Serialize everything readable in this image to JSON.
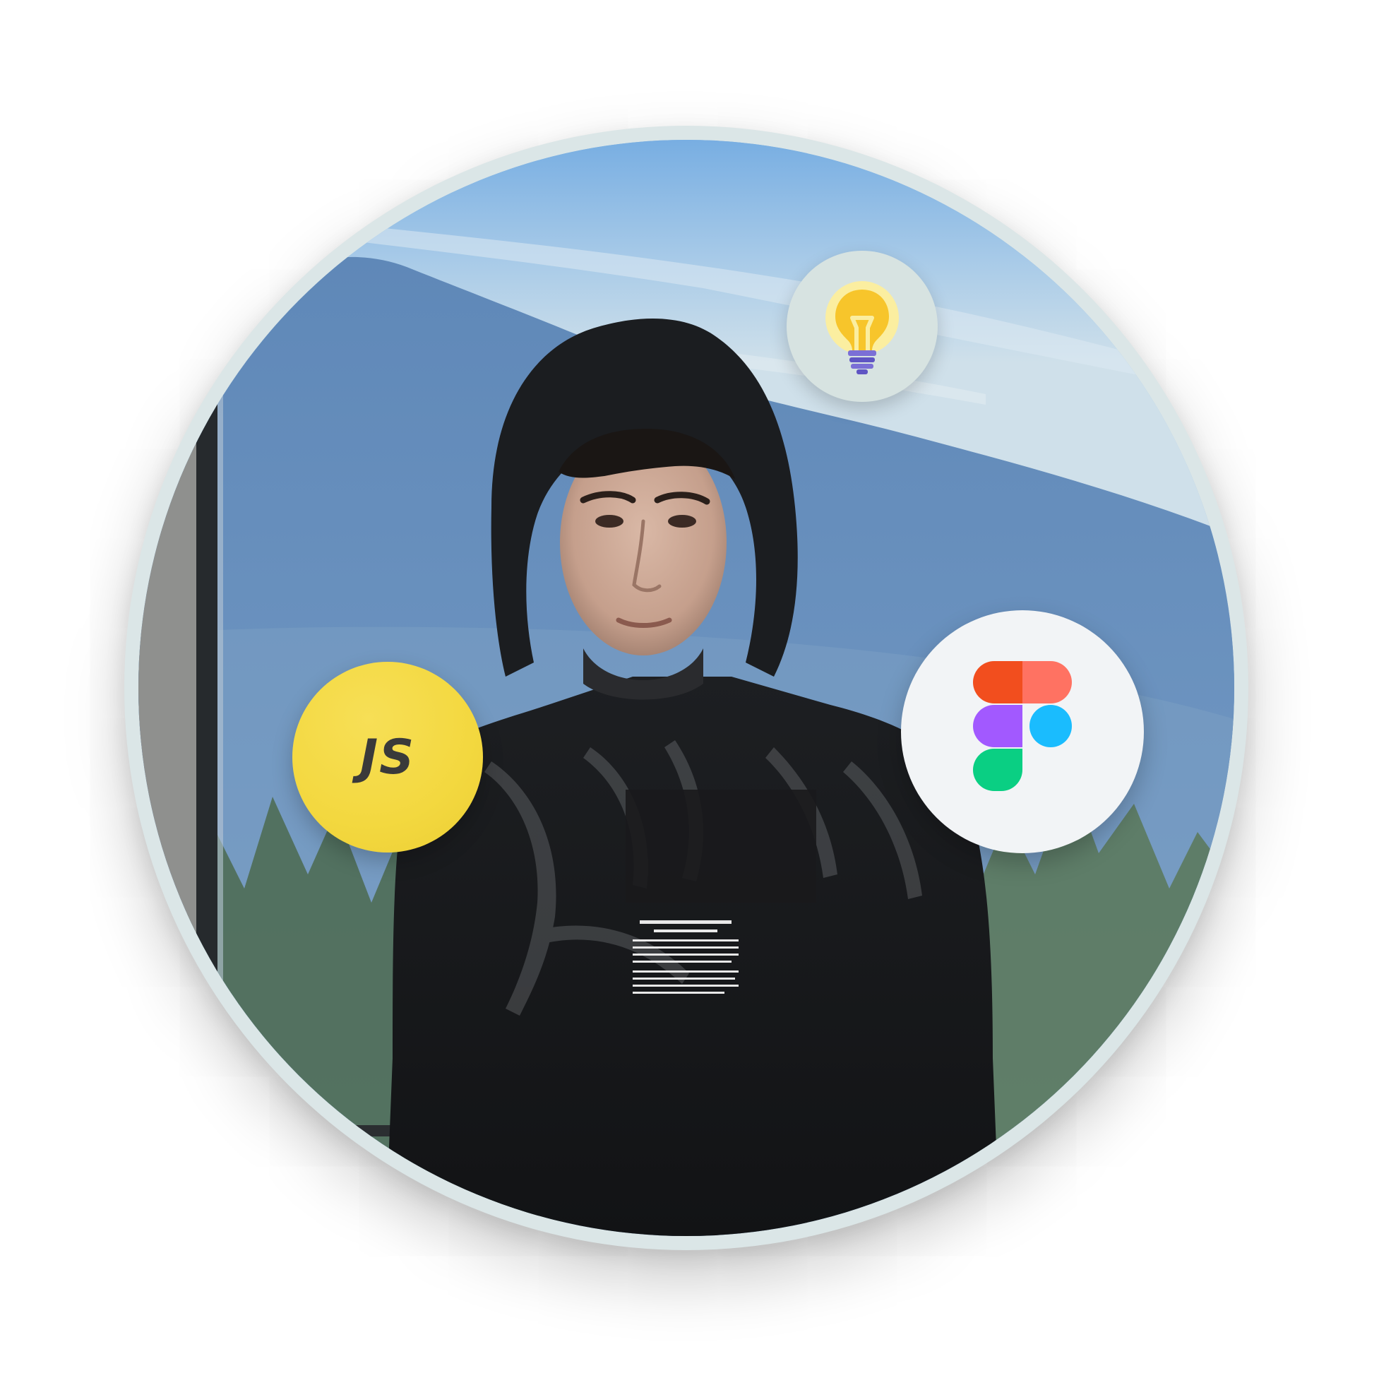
{
  "avatar": {
    "description_name": "profile-photo"
  },
  "badges": {
    "idea": {
      "icon": "lightbulb-icon",
      "bg": "#d7e3e1"
    },
    "js": {
      "icon": "javascript-icon",
      "label": "JS",
      "bg": "#f3d83f"
    },
    "figma": {
      "icon": "figma-icon",
      "bg": "#f2f4f6"
    }
  },
  "colors": {
    "ring": "#dbe6e7",
    "figma_red": "#f24e1e",
    "figma_orange": "#ff7262",
    "figma_purple": "#a259ff",
    "figma_blue": "#1abcfe",
    "figma_green": "#0acf83",
    "bulb_yellow": "#f7c52b",
    "bulb_glow": "#fbeea0",
    "bulb_base": "#7b6fd6"
  }
}
